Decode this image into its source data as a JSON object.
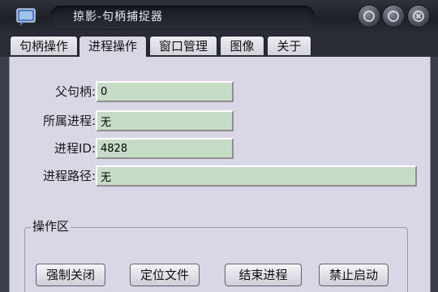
{
  "window": {
    "title": "掠影-句柄捕捉器"
  },
  "tabs": [
    {
      "label": "句柄操作"
    },
    {
      "label": "进程操作"
    },
    {
      "label": "窗口管理"
    },
    {
      "label": "图像"
    },
    {
      "label": "关于"
    }
  ],
  "fields": {
    "parent_handle": {
      "label": "父句柄:",
      "value": "0"
    },
    "process": {
      "label": "所属进程:",
      "value": "无"
    },
    "process_id": {
      "label": "进程ID:",
      "value": "4828"
    },
    "process_path": {
      "label": "进程路径:",
      "value": "无"
    }
  },
  "operations": {
    "title": "操作区",
    "buttons": [
      {
        "label": "强制关闭"
      },
      {
        "label": "定位文件"
      },
      {
        "label": "结束进程"
      },
      {
        "label": "禁止启动"
      }
    ]
  },
  "colors": {
    "field_bg": "#c7dcc6",
    "panel_bg": "#d9d7e6",
    "titlebar": "#1f2028"
  }
}
